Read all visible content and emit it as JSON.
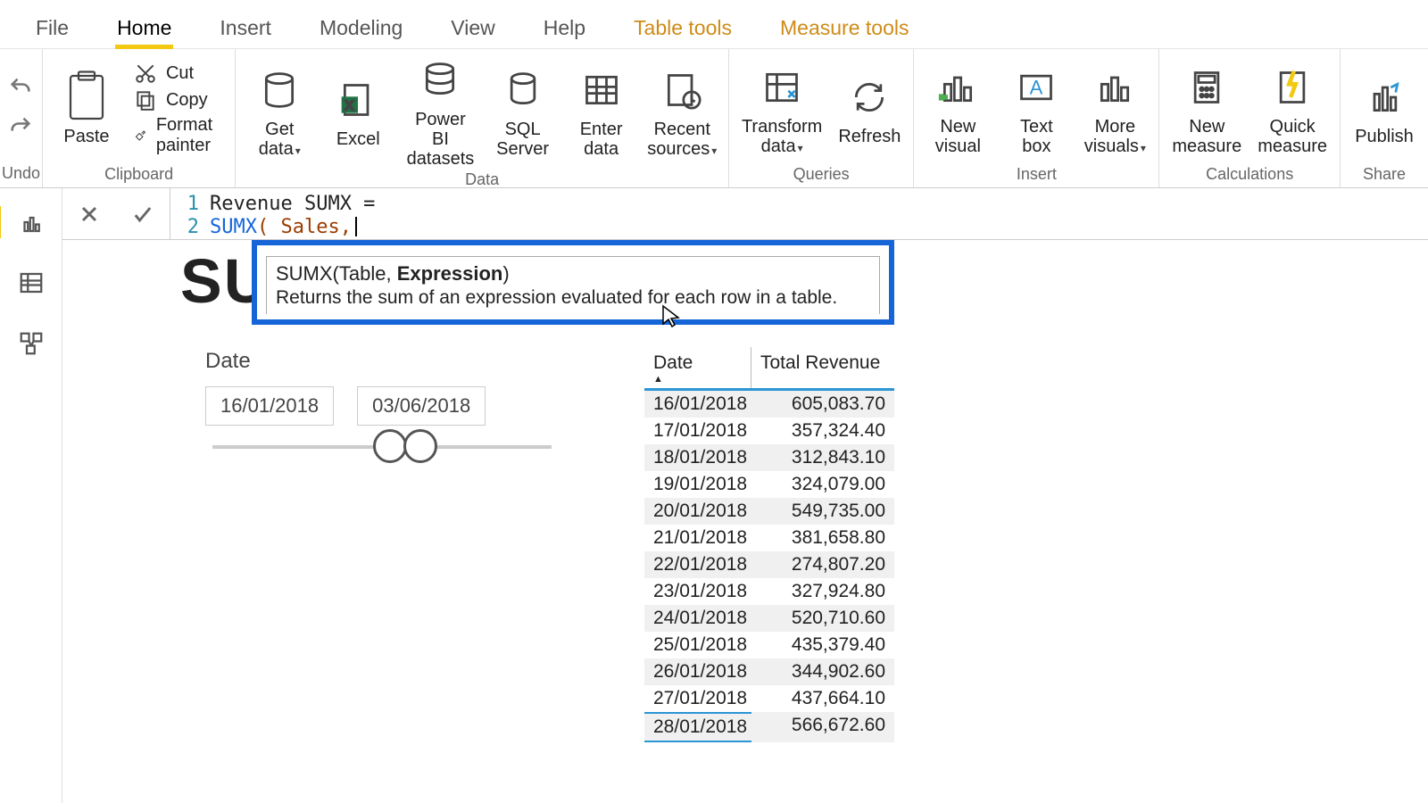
{
  "menu": {
    "file": "File",
    "home": "Home",
    "insert": "Insert",
    "modeling": "Modeling",
    "view": "View",
    "help": "Help",
    "table_tools": "Table tools",
    "measure_tools": "Measure tools"
  },
  "ribbon": {
    "undo_group": "Undo",
    "clipboard": {
      "paste": "Paste",
      "cut": "Cut",
      "copy": "Copy",
      "format_painter": "Format painter",
      "group": "Clipboard"
    },
    "data": {
      "get_data": "Get\ndata",
      "excel": "Excel",
      "pbi_datasets": "Power BI\ndatasets",
      "sql": "SQL\nServer",
      "enter": "Enter\ndata",
      "recent": "Recent\nsources",
      "group": "Data"
    },
    "queries": {
      "transform": "Transform\ndata",
      "refresh": "Refresh",
      "group": "Queries"
    },
    "insert": {
      "new_visual": "New\nvisual",
      "text_box": "Text\nbox",
      "more_visuals": "More\nvisuals",
      "group": "Insert"
    },
    "calc": {
      "new_measure": "New\nmeasure",
      "quick_measure": "Quick\nmeasure",
      "group": "Calculations"
    },
    "share": {
      "publish": "Publish",
      "group": "Share"
    }
  },
  "formula": {
    "line1": "Revenue SUMX =",
    "line2_func": "SUMX",
    "line2_arg": "( Sales,"
  },
  "tooltip": {
    "sig_pre": "SUMX(Table, ",
    "sig_bold": "Expression",
    "sig_post": ")",
    "desc": "Returns the sum of an expression evaluated for each row in a table."
  },
  "bg_text": "SU",
  "slicer": {
    "label": "Date",
    "start": "16/01/2018",
    "end": "03/06/2018"
  },
  "table": {
    "col_date": "Date",
    "col_rev": "Total Revenue",
    "rows": [
      {
        "d": "16/01/2018",
        "v": "605,083.70"
      },
      {
        "d": "17/01/2018",
        "v": "357,324.40"
      },
      {
        "d": "18/01/2018",
        "v": "312,843.10"
      },
      {
        "d": "19/01/2018",
        "v": "324,079.00"
      },
      {
        "d": "20/01/2018",
        "v": "549,735.00"
      },
      {
        "d": "21/01/2018",
        "v": "381,658.80"
      },
      {
        "d": "22/01/2018",
        "v": "274,807.20"
      },
      {
        "d": "23/01/2018",
        "v": "327,924.80"
      },
      {
        "d": "24/01/2018",
        "v": "520,710.60"
      },
      {
        "d": "25/01/2018",
        "v": "435,379.40"
      },
      {
        "d": "26/01/2018",
        "v": "344,902.60"
      },
      {
        "d": "27/01/2018",
        "v": "437,664.10"
      },
      {
        "d": "28/01/2018",
        "v": "566,672.60"
      }
    ]
  }
}
